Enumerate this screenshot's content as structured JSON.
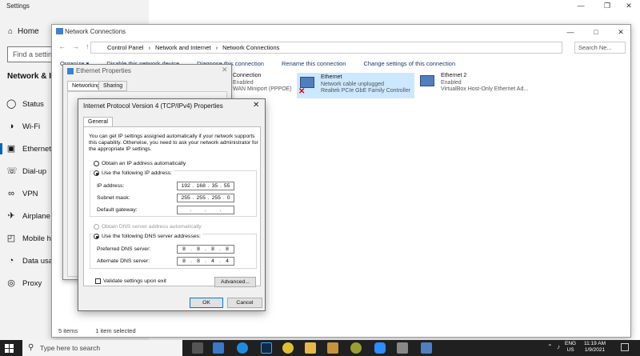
{
  "settings": {
    "title": "Settings",
    "home": "Home",
    "search_placeholder": "Find a setting",
    "section": "Network & Internet",
    "nav": [
      {
        "label": "Status",
        "icon": "status-icon"
      },
      {
        "label": "Wi-Fi",
        "icon": "wifi-icon"
      },
      {
        "label": "Ethernet",
        "icon": "ethernet-icon"
      },
      {
        "label": "Dial-up",
        "icon": "dialup-icon"
      },
      {
        "label": "VPN",
        "icon": "vpn-icon"
      },
      {
        "label": "Airplane mode",
        "icon": "airplane-icon"
      },
      {
        "label": "Mobile hotspot",
        "icon": "hotspot-icon"
      },
      {
        "label": "Data usage",
        "icon": "data-usage-icon"
      },
      {
        "label": "Proxy",
        "icon": "proxy-icon"
      }
    ]
  },
  "network": {
    "title": "Network Connections",
    "breadcrumb": [
      "Control Panel",
      "Network and Internet",
      "Network Connections"
    ],
    "search_placeholder": "Search Ne...",
    "toolbar": [
      "Organize ▾",
      "Disable this network device",
      "Diagnose this connection",
      "Rename this connection",
      "Change settings of this connection"
    ],
    "connections": [
      {
        "name": "Connection",
        "line1": "Enabled",
        "line2": "WAN Miniport (PPPOE)"
      },
      {
        "name": "Ethernet",
        "line1": "Network cable unplugged",
        "line2": "Realtek PCIe GbE Family Controller"
      },
      {
        "name": "Ethernet 2",
        "line1": "Enabled",
        "line2": "VirtualBox Host-Only Ethernet Ad..."
      }
    ],
    "status": {
      "items": "5 items",
      "selected": "1 item selected"
    }
  },
  "ethernet_props": {
    "title": "Ethernet Properties",
    "tabs": [
      "Networking",
      "Sharing"
    ]
  },
  "ipv4": {
    "title": "Internet Protocol Version 4 (TCP/IPv4) Properties",
    "tab": "General",
    "description": "You can get IP settings assigned automatically if your network supports this capability. Otherwise, you need to ask your network administrator for the appropriate IP settings.",
    "obtain_ip": "Obtain an IP address automatically",
    "use_ip": "Use the following IP address:",
    "ip_label": "IP address:",
    "ip": [
      "192",
      "168",
      "35",
      "55"
    ],
    "mask_label": "Subnet mask:",
    "mask": [
      "255",
      "255",
      "255",
      "0"
    ],
    "gateway_label": "Default gateway:",
    "gateway": [
      "",
      "",
      "",
      ""
    ],
    "obtain_dns": "Obtain DNS server address automatically",
    "use_dns": "Use the following DNS server addresses:",
    "pref_dns_label": "Preferred DNS server:",
    "pref_dns": [
      "8",
      "8",
      "8",
      "8"
    ],
    "alt_dns_label": "Alternate DNS server:",
    "alt_dns": [
      "8",
      "8",
      "4",
      "4"
    ],
    "validate": "Validate settings upon exit",
    "advanced": "Advanced...",
    "ok": "OK",
    "cancel": "Cancel"
  },
  "taskbar": {
    "search": "Type here to search",
    "lang1": "ENG",
    "lang2": "US",
    "time": "11:19 AM",
    "date": "1/9/2021"
  }
}
